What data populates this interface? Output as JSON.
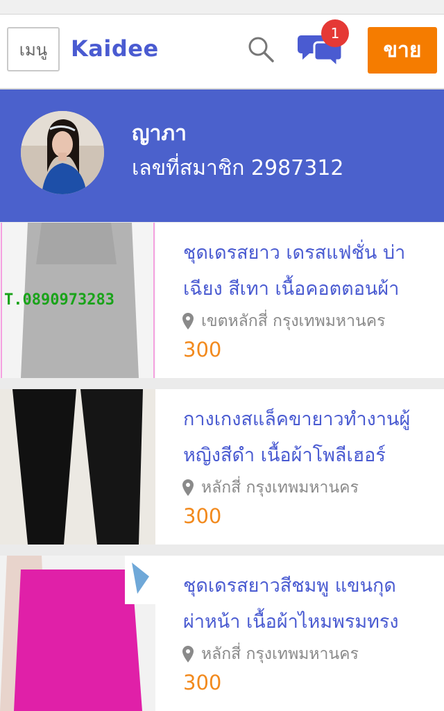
{
  "header": {
    "menu_label": "เมนู",
    "logo": "Kaidee",
    "chat_badge": "1",
    "sell_label": "ขาย",
    "icons": [
      "search-icon",
      "chat-icon"
    ]
  },
  "profile": {
    "name": "ญาภา",
    "member_id": "เลขที่สมาชิก 2987312"
  },
  "listings": [
    {
      "title_line1": "ชุดเดรสยาว เดรสแฟชั่น บ่า",
      "title_line2": "เฉียง สีเทา เนื้อคอตตอนผ้า",
      "location": "เขตหลักสี่ กรุงเทพมหานคร",
      "price": "300",
      "watermark": "T.0890973283"
    },
    {
      "title_line1": "กางเกงสแล็คขายาวทำงานผู้",
      "title_line2": "หญิงสีดำ เนื้อผ้าโพลีเฮอร์",
      "location": "หลักสี่ กรุงเทพมหานคร",
      "price": "300"
    },
    {
      "title_line1": "ชุดเดรสยาวสีชมพู แขนกุด",
      "title_line2": "ผ่าหน้า เนื้อผ้าไหมพรมทรง",
      "location": "หลักสี่ กรุงเทพมหานคร",
      "price": "300"
    }
  ],
  "colors": {
    "brand_blue": "#4b61cc",
    "sell_orange": "#f57c00",
    "price_orange": "#f28a1e",
    "badge_red": "#e53935"
  }
}
